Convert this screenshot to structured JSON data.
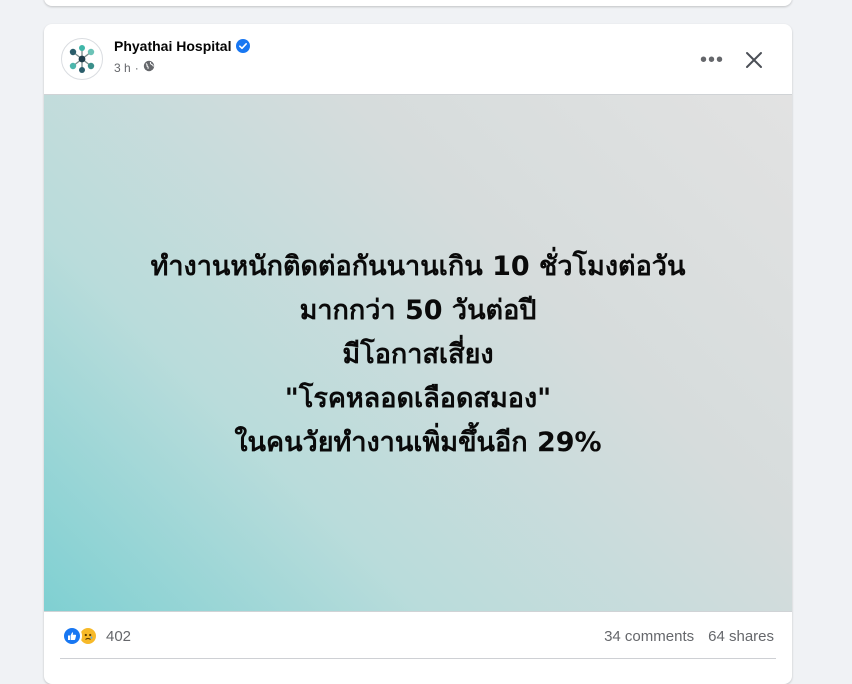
{
  "post": {
    "page_name": "Phyathai Hospital",
    "verified_icon": "verified-badge-icon",
    "time": "3 h",
    "separator": "·",
    "audience_icon": "globe-icon",
    "more_label": "•••",
    "close_icon": "close-icon"
  },
  "image": {
    "lines": [
      "ทำงานหนักติดต่อกันนานเกิน 10 ชั่วโมงต่อวัน",
      "มากกว่า 50 วันต่อปี",
      "มีโอกาสเสี่ยง",
      "\"โรคหลอดเลือดสมอง\"",
      "ในคนวัยทำงานเพิ่มขึ้นอีก 29%"
    ]
  },
  "footer": {
    "reaction_icons": [
      "like-icon",
      "sad-icon"
    ],
    "reaction_count": "402",
    "comments": "34 comments",
    "shares": "64 shares"
  },
  "colors": {
    "brand_blue": "#1877f2",
    "secondary_text": "#65676b",
    "image_gradient": [
      "#e2e2e2",
      "#7fd0d2"
    ]
  }
}
